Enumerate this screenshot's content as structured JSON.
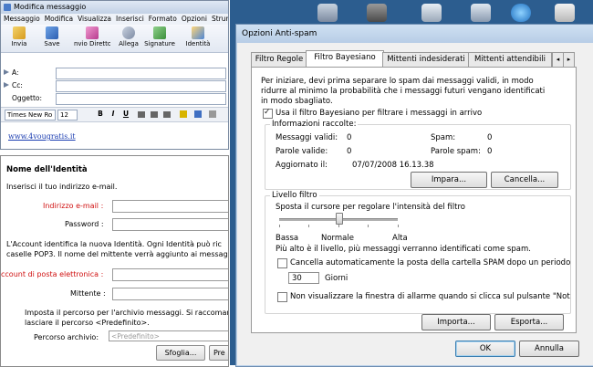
{
  "compose": {
    "title": "Modifica messaggio",
    "menu": [
      "Messaggio",
      "Modifica",
      "Visualizza",
      "Inserisci",
      "Formato",
      "Opzioni",
      "Strumenti"
    ],
    "toolbar": [
      "Invia",
      "Save",
      "nvio Diretto",
      "Allega",
      "Signature",
      "Identità"
    ],
    "fields": {
      "a": "A:",
      "cc": "Cc:",
      "oggetto": "Oggetto:"
    },
    "font": "Times New Ro",
    "size": "12",
    "format_buttons": [
      "B",
      "I",
      "U"
    ],
    "body_link": "www.4vougratis.it"
  },
  "identity": {
    "heading": "Nome dell'Identità",
    "intro": "Inserisci il tuo indirizzo e-mail.",
    "email_label": "Indirizzo e-mail :",
    "password_label": "Password :",
    "note_line1": "L'Account identifica la nuova Identità. Ogni Identità può ric",
    "note_line2": "caselle POP3. Il nome del mittente verrà aggiunto ai messag",
    "account_label": "ccount di posta elettronica :",
    "mittente_label": "Mittente :",
    "archive_line1": "Imposta il percorso per l'archivio messaggi. Si raccomanda",
    "archive_line2": "lasciare il percorso <Predefinito>.",
    "archive_label": "Percorso archivio:",
    "archive_placeholder": "<Predefinito>",
    "browse_button": "Sfoglia...",
    "next_button_partial": "Pre"
  },
  "dialog": {
    "title": "Opzioni Anti-spam",
    "tabs": [
      "Filtro Regole",
      "Filtro Bayesiano",
      "Mittenti indesiderati",
      "Mittenti attendibili"
    ],
    "intro": [
      "Per iniziare, devi prima separare lo spam dai messaggi validi, in modo",
      "ridurre al minimo la probabilità che i messaggi futuri vengano identificati",
      "in modo sbagliato."
    ],
    "use_filter_label": "Usa il filtro Bayesiano per filtrare i messaggi in arrivo",
    "use_filter_checked": true,
    "info_group": "Informazioni raccolte:",
    "stats": {
      "valid_messages_label": "Messaggi validi:",
      "valid_messages": "0",
      "spam_label": "Spam:",
      "spam": "0",
      "valid_words_label": "Parole valide:",
      "valid_words": "0",
      "spam_words_label": "Parole spam:",
      "spam_words": "0",
      "updated_label": "Aggiornato il:",
      "updated": "07/07/2008 16.13.38"
    },
    "learn_button": "Impara...",
    "cancel_data_button": "Cancella...",
    "level_group": "Livello filtro",
    "slider_caption": "Sposta il cursore per regolare l'intensità del filtro",
    "slider_level": 0.5,
    "levels": [
      "Bassa",
      "Normale",
      "Alta"
    ],
    "level_note": "Più alto è il livello, più messaggi verranno identificati come spam.",
    "auto_delete_label": "Cancella automaticamente la posta della cartella SPAM dopo un periodo",
    "auto_delete_checked": false,
    "days_value": "30",
    "days_label": "Giorni",
    "no_alarm_label": "Non visualizzare la finestra di allarme quando si clicca sul pulsante \"Not",
    "no_alarm_checked": false,
    "import_button": "Importa...",
    "export_button": "Esporta...",
    "ok_button": "OK",
    "cancel_button": "Annulla"
  }
}
